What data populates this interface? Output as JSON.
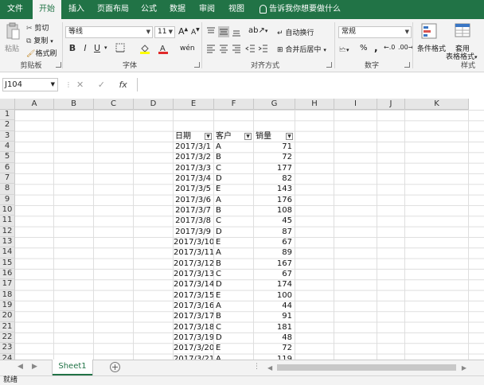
{
  "ribbon_tabs": [
    "文件",
    "开始",
    "插入",
    "页面布局",
    "公式",
    "数据",
    "审阅",
    "视图"
  ],
  "tell_me": "告诉我你想要做什么",
  "clipboard": {
    "paste": "粘贴",
    "cut": "剪切",
    "copy": "复制",
    "format_painter": "格式刷",
    "group": "剪贴板"
  },
  "font": {
    "name": "等线",
    "size": "11",
    "grow": "A",
    "shrink": "A",
    "bold": "B",
    "italic": "I",
    "underline": "U",
    "group": "字体"
  },
  "alignment": {
    "wrap": "自动换行",
    "merge": "合并后居中",
    "group": "对齐方式"
  },
  "number": {
    "format": "常规",
    "percent": "%",
    "comma": ",",
    "group": "数字"
  },
  "styles": {
    "conditional": "条件格式",
    "table_line1": "套用",
    "table_line2": "表格格式",
    "group": "样式"
  },
  "name_box": "J104",
  "formula_icons": {
    "cancel": "✕",
    "enter": "✓",
    "fx": "fx"
  },
  "columns": [
    "A",
    "B",
    "C",
    "D",
    "E",
    "F",
    "G",
    "H",
    "I",
    "J",
    "K"
  ],
  "rows": [
    "1",
    "2",
    "3",
    "4",
    "5",
    "6",
    "7",
    "8",
    "9",
    "10",
    "11",
    "12",
    "13",
    "14",
    "15",
    "16",
    "17",
    "18",
    "19",
    "20",
    "21",
    "22",
    "23",
    "24"
  ],
  "headers": {
    "date": "日期",
    "customer": "客户",
    "sales": "销量"
  },
  "table": [
    {
      "date": "2017/3/1",
      "customer": "A",
      "sales": "71"
    },
    {
      "date": "2017/3/2",
      "customer": "B",
      "sales": "72"
    },
    {
      "date": "2017/3/3",
      "customer": "C",
      "sales": "177"
    },
    {
      "date": "2017/3/4",
      "customer": "D",
      "sales": "82"
    },
    {
      "date": "2017/3/5",
      "customer": "E",
      "sales": "143"
    },
    {
      "date": "2017/3/6",
      "customer": "A",
      "sales": "176"
    },
    {
      "date": "2017/3/7",
      "customer": "B",
      "sales": "108"
    },
    {
      "date": "2017/3/8",
      "customer": "C",
      "sales": "45"
    },
    {
      "date": "2017/3/9",
      "customer": "D",
      "sales": "87"
    },
    {
      "date": "2017/3/10",
      "customer": "E",
      "sales": "67"
    },
    {
      "date": "2017/3/11",
      "customer": "A",
      "sales": "89"
    },
    {
      "date": "2017/3/12",
      "customer": "B",
      "sales": "167"
    },
    {
      "date": "2017/3/13",
      "customer": "C",
      "sales": "67"
    },
    {
      "date": "2017/3/14",
      "customer": "D",
      "sales": "174"
    },
    {
      "date": "2017/3/15",
      "customer": "E",
      "sales": "100"
    },
    {
      "date": "2017/3/16",
      "customer": "A",
      "sales": "44"
    },
    {
      "date": "2017/3/17",
      "customer": "B",
      "sales": "91"
    },
    {
      "date": "2017/3/18",
      "customer": "C",
      "sales": "181"
    },
    {
      "date": "2017/3/19",
      "customer": "D",
      "sales": "48"
    },
    {
      "date": "2017/3/20",
      "customer": "E",
      "sales": "72"
    },
    {
      "date": "2017/3/21",
      "customer": "A",
      "sales": "119"
    }
  ],
  "sheet_tab": "Sheet1",
  "add_sheet": "+",
  "status": "就绪",
  "colors": {
    "brand": "#217346",
    "ribbon_bg": "#f3f3f3",
    "header_bg": "#e6e6e6",
    "gridline": "#dedede"
  }
}
